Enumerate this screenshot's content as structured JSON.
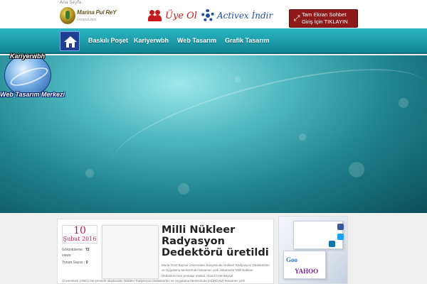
{
  "breadcrumb": "Ana Sayfa",
  "logo": {
    "title": "Marina Pul ReY",
    "subtitle": "ForumiLines"
  },
  "top_links": {
    "register": "Üye Ol",
    "activex": "Activex İndir"
  },
  "chat_button": {
    "line1": "Tam Ekran Sohbet",
    "line2": "Giriş İçin TIKLAYIN",
    "icon": "expand-arrows-icon"
  },
  "nav": {
    "home_icon": "home-icon",
    "items": [
      "Baskılı Poşet",
      "Kariyerwbh",
      "Web Tasarım",
      "Grafik Tasarım"
    ]
  },
  "hero_logo": {
    "top": "Kariyerwbh",
    "bottom": "Web Tasarım Merkezi"
  },
  "post": {
    "day": "10",
    "month_year": "Şubat 2016",
    "views_label": "Görüntüleme :",
    "views_value": "72",
    "views_unit": "views",
    "comments_label": "Yorum Sayısı :",
    "comments_value": "0",
    "title": "Milli Nükleer Radyasyon Dedektörü üretildi",
    "excerpt": "Murat İzzet Baysal Üniversitesi bünyesinde Nükleer Radyasyon Dedektörleri ve Uygulama Merkezinde tamamen yerli imkanlarla 'Milli Nükleer Dedektörü'nün prototipi üretildi. Abant İzzet Baysal",
    "excerpt_continued": "Üniversitesi (AİBÜ) bünyesinde oluşturulan Nükleer Radyasyon Dedektörleri ve Uygulama Merkezinde (NÜRDAM) tamamen yerli"
  },
  "colors": {
    "navbar": "#1fa3b2",
    "chat_button": "#8e1a1a",
    "register_link": "#c21c1c",
    "activex_link": "#1d4fa0",
    "date": "#c0174f"
  }
}
